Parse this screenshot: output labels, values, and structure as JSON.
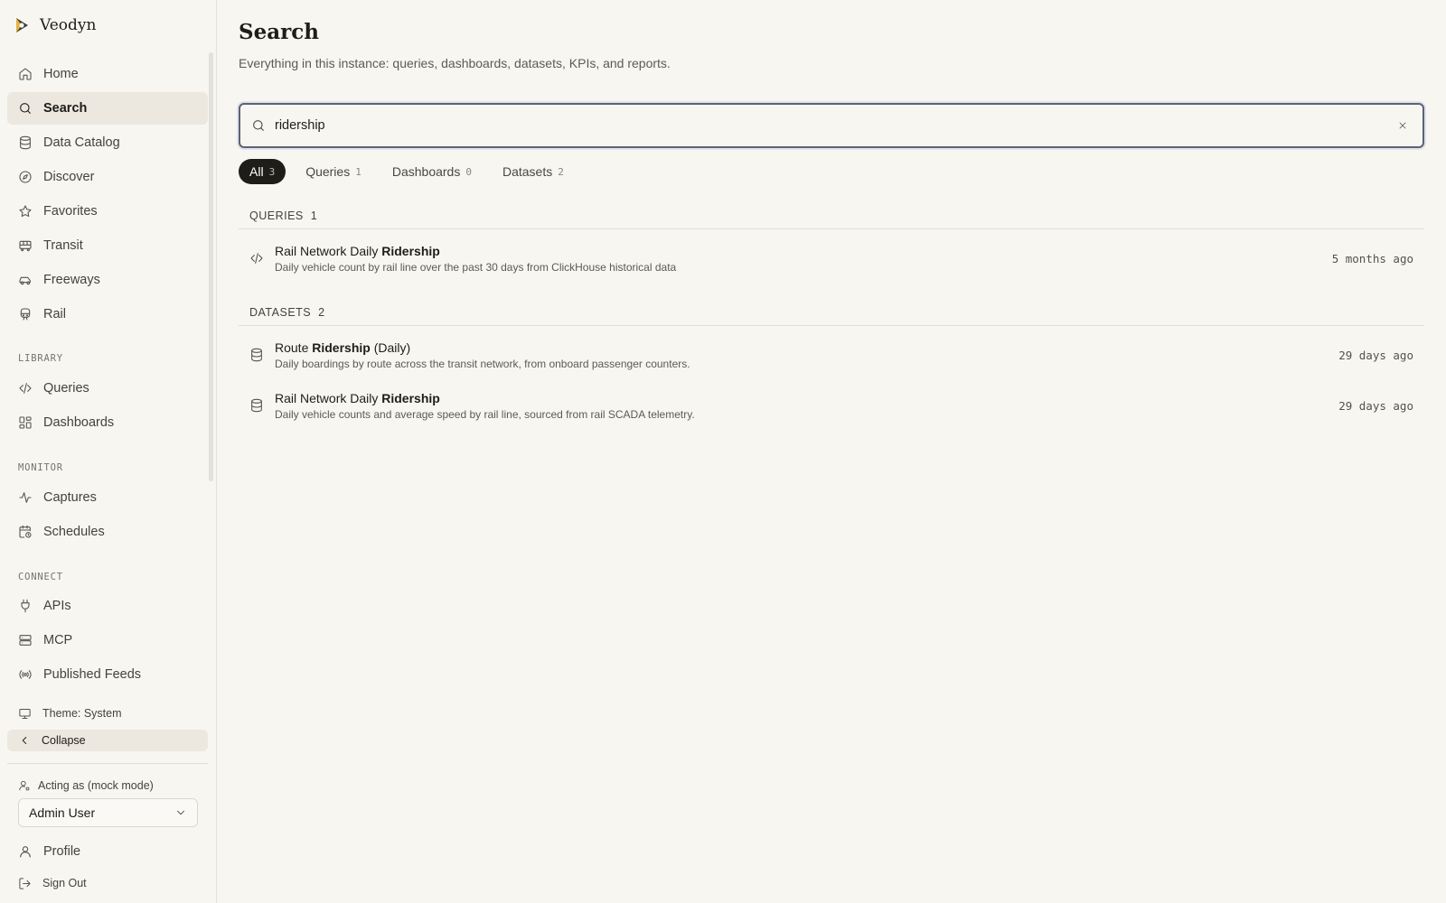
{
  "app": {
    "name": "Veodyn"
  },
  "sidebar": {
    "nav": [
      {
        "label": "Home",
        "icon": "home-icon"
      },
      {
        "label": "Search",
        "icon": "search-icon",
        "active": true
      },
      {
        "label": "Data Catalog",
        "icon": "database-icon"
      },
      {
        "label": "Discover",
        "icon": "compass-icon"
      },
      {
        "label": "Favorites",
        "icon": "star-icon"
      },
      {
        "label": "Transit",
        "icon": "bus-icon"
      },
      {
        "label": "Freeways",
        "icon": "car-icon"
      },
      {
        "label": "Rail",
        "icon": "train-icon"
      }
    ],
    "library": {
      "title": "LIBRARY",
      "items": [
        {
          "label": "Queries",
          "icon": "code-icon"
        },
        {
          "label": "Dashboards",
          "icon": "dashboard-icon"
        }
      ]
    },
    "monitor": {
      "title": "MONITOR",
      "items": [
        {
          "label": "Captures",
          "icon": "activity-icon"
        },
        {
          "label": "Schedules",
          "icon": "calendar-clock-icon"
        }
      ]
    },
    "connect": {
      "title": "CONNECT",
      "items": [
        {
          "label": "APIs",
          "icon": "plug-icon"
        },
        {
          "label": "MCP",
          "icon": "server-icon"
        },
        {
          "label": "Published Feeds",
          "icon": "radio-icon"
        }
      ]
    },
    "theme_label": "Theme: System",
    "collapse_label": "Collapse",
    "acting_as_label": "Acting as (mock mode)",
    "acting_user": "Admin User",
    "profile_label": "Profile",
    "signout_label": "Sign Out"
  },
  "page": {
    "title": "Search",
    "subtitle": "Everything in this instance: queries, dashboards, datasets, KPIs, and reports."
  },
  "search": {
    "value": "ridership",
    "placeholder": ""
  },
  "tabs": [
    {
      "label": "All",
      "count": "3",
      "active": true
    },
    {
      "label": "Queries",
      "count": "1"
    },
    {
      "label": "Dashboards",
      "count": "0"
    },
    {
      "label": "Datasets",
      "count": "2"
    }
  ],
  "groups": [
    {
      "title": "QUERIES",
      "count": "1",
      "results": [
        {
          "icon": "code-icon",
          "title_pre": "Rail Network Daily ",
          "title_match": "Ridership",
          "title_post": "",
          "desc": "Daily vehicle count by rail line over the past 30 days from ClickHouse historical data",
          "time": "5 months ago"
        }
      ]
    },
    {
      "title": "DATASETS",
      "count": "2",
      "results": [
        {
          "icon": "database-icon",
          "title_pre": "Route ",
          "title_match": "Ridership",
          "title_post": " (Daily)",
          "desc": "Daily boardings by route across the transit network, from onboard passenger counters.",
          "time": "29 days ago"
        },
        {
          "icon": "database-icon",
          "title_pre": "Rail Network Daily ",
          "title_match": "Ridership",
          "title_post": "",
          "desc": "Daily vehicle counts and average speed by rail line, sourced from rail SCADA telemetry.",
          "time": "29 days ago"
        }
      ]
    }
  ]
}
